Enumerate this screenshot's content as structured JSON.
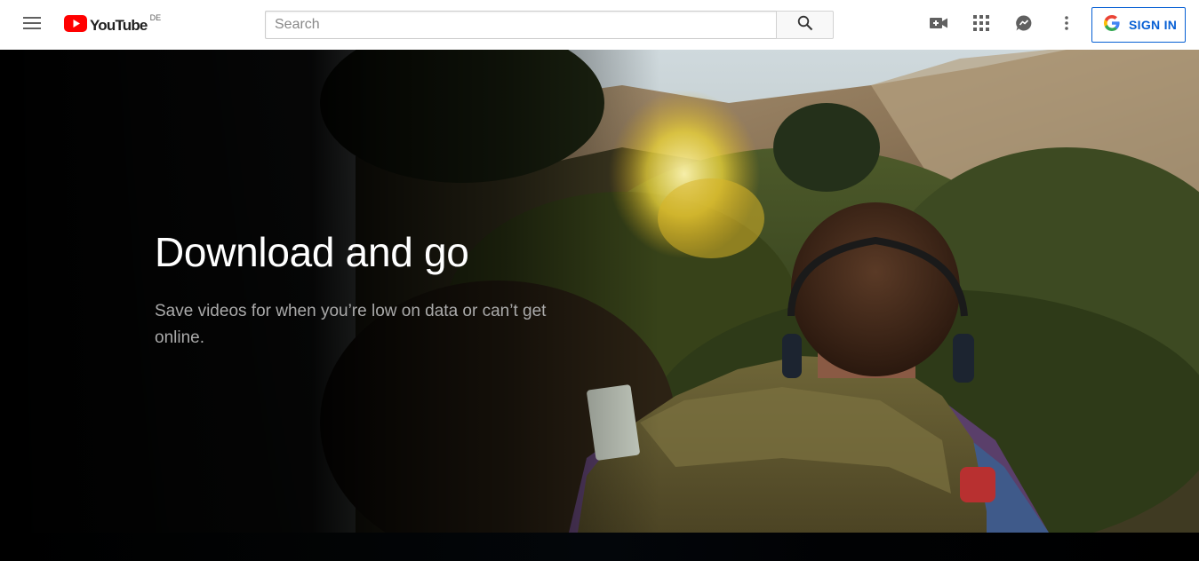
{
  "masthead": {
    "logo_text": "YouTube",
    "country_code": "DE",
    "search": {
      "placeholder": "Search",
      "value": ""
    },
    "signin_label": "SIGN IN",
    "icons": [
      "menu-icon",
      "youtube-play-icon",
      "search-icon",
      "create-video-icon",
      "apps-grid-icon",
      "messages-icon",
      "more-vert-icon",
      "google-g-icon"
    ]
  },
  "hero": {
    "title": "Download and go",
    "subtitle": "Save videos for when you’re low on data or can’t get online."
  },
  "colors": {
    "brand_red": "#ff0000",
    "accent_blue": "#065fd4",
    "hero_bg": "#0b0f0a",
    "subtitle_gray": "#aaaaaa"
  }
}
